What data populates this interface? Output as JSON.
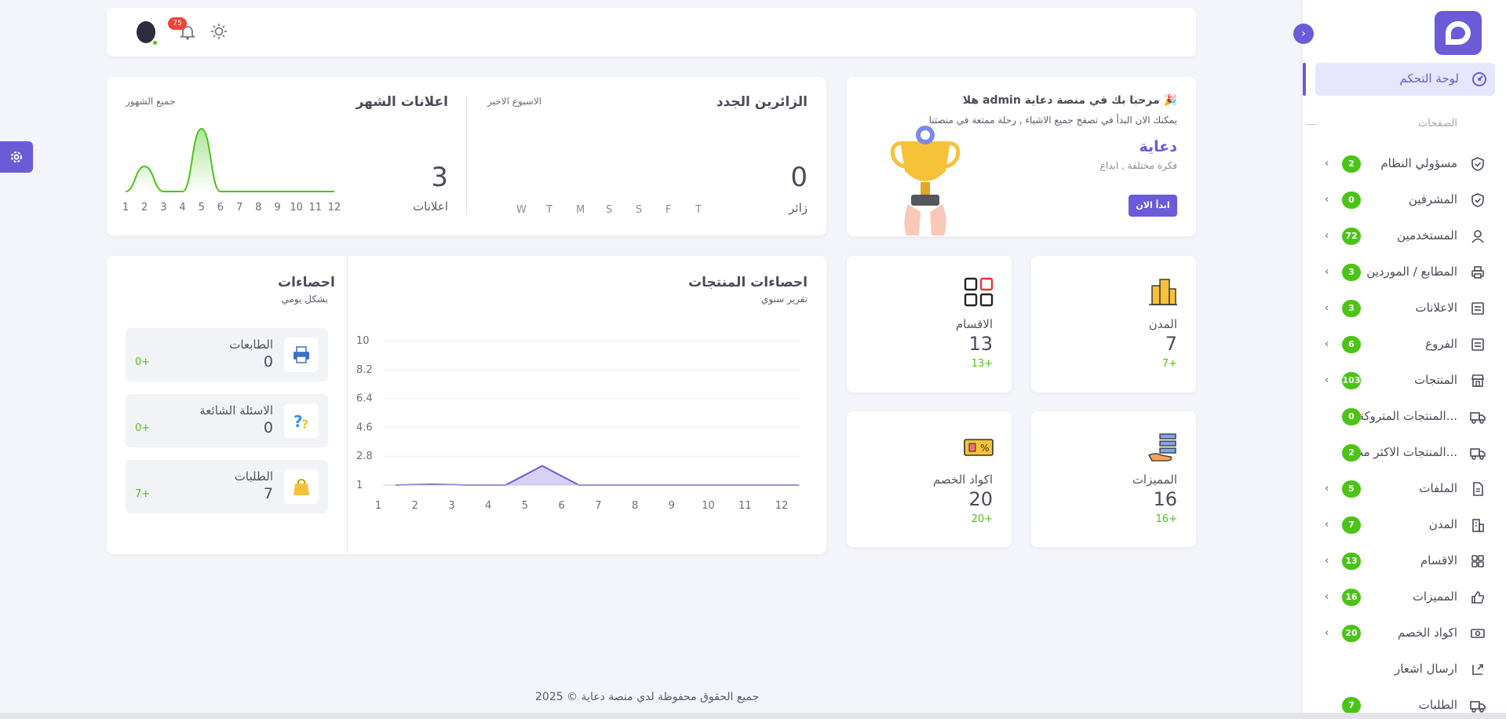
{
  "colors": {
    "accent": "#6b5bd6",
    "success": "#4cc417",
    "danger": "#f04438"
  },
  "header": {
    "notification_count": "75"
  },
  "sidebar": {
    "dashboard_label": "لوحة التحكم",
    "section_pages": "الصفحات",
    "items": [
      {
        "label": "مسؤولي النظام",
        "badge": "2",
        "icon": "shield-icon"
      },
      {
        "label": "المشرفين",
        "badge": "0",
        "icon": "shield-icon"
      },
      {
        "label": "المستخدمين",
        "badge": "72",
        "icon": "user-icon"
      },
      {
        "label": "المطابع / الموردين",
        "badge": "3",
        "icon": "printer-icon"
      },
      {
        "label": "الاعلانات",
        "badge": "3",
        "icon": "list-icon"
      },
      {
        "label": "الفروع",
        "badge": "6",
        "icon": "list-icon"
      },
      {
        "label": "المنتجات",
        "badge": "103",
        "icon": "store-icon"
      },
      {
        "label": "المنتجات المتروكة...",
        "badge": "0",
        "icon": "truck-icon"
      },
      {
        "label": "المنتجات الاكثر مب...",
        "badge": "2",
        "icon": "truck-icon"
      },
      {
        "label": "الملفات",
        "badge": "5",
        "icon": "file-icon"
      },
      {
        "label": "المدن",
        "badge": "7",
        "icon": "building-icon"
      },
      {
        "label": "الاقسام",
        "badge": "13",
        "icon": "grid-icon"
      },
      {
        "label": "المميزات",
        "badge": "16",
        "icon": "thumbs-up-icon"
      },
      {
        "label": "اكواد الخصم",
        "badge": "20",
        "icon": "ticket-icon"
      },
      {
        "label": "ارسال اشعار",
        "badge": "",
        "icon": "send-icon"
      },
      {
        "label": "الطلبات",
        "badge": "7",
        "icon": "truck-icon"
      }
    ]
  },
  "welcome": {
    "greeting": "هلا admin مرحبا بك في منصة دعاية 🎉",
    "subtitle": "يمكنك الان البدأ في تصفح جميع الاشياء , رحلة ممتعة في منصتنا",
    "brand": "دعاية",
    "tagline": "فكرة مختلفة , ابداع",
    "cta": "ابدأ الان"
  },
  "visitors": {
    "title": "الزائرين الجدد",
    "period": "الاسبوع الاخير",
    "value": "0",
    "unit": "زائر",
    "days": [
      "T",
      "F",
      "S",
      "S",
      "M",
      "T",
      "W"
    ]
  },
  "monthly_ads": {
    "title": "اعلانات الشهر",
    "period": "جميع الشهور",
    "value": "3",
    "unit": "اعلانات"
  },
  "stats": [
    {
      "label": "المدن",
      "value": "7",
      "delta": "7+",
      "icon": "city-icon"
    },
    {
      "label": "الاقسام",
      "value": "13",
      "delta": "13+",
      "icon": "categories-icon"
    },
    {
      "label": "المميزات",
      "value": "16",
      "delta": "16+",
      "icon": "features-icon"
    },
    {
      "label": "اكواد الخصم",
      "value": "20",
      "delta": "20+",
      "icon": "coupon-icon"
    }
  ],
  "product_stats": {
    "title": "احصاءات المنتجات",
    "subtitle": "تقرير سنوي"
  },
  "daily_stats": {
    "title": "احصاءات",
    "subtitle": "بشكل يومي",
    "rows": [
      {
        "label": "الطابعات",
        "value": "0",
        "delta": "0+",
        "icon": "printer-icon"
      },
      {
        "label": "الاسئلة الشائعة",
        "value": "0",
        "delta": "0+",
        "icon": "question-icon"
      },
      {
        "label": "الطلبات",
        "value": "7",
        "delta": "7+",
        "icon": "bag-icon"
      }
    ]
  },
  "footer": {
    "text": "جميع الحقوق محفوظة لدي منصة دعاية © 2025"
  },
  "chart_data": [
    {
      "type": "area",
      "x": [
        1,
        2,
        3,
        4,
        5,
        6,
        7,
        8,
        9,
        10,
        11,
        12
      ],
      "values": [
        0,
        1,
        0,
        0,
        2.5,
        0,
        0,
        0,
        0,
        0,
        0,
        0
      ],
      "xlabel": "",
      "ylabel": "",
      "grid": false
    },
    {
      "type": "area",
      "x": [
        1,
        2,
        3,
        4,
        5,
        6,
        7,
        8,
        9,
        10,
        11,
        12
      ],
      "values": [
        1,
        1.05,
        1,
        1,
        2.2,
        1,
        1,
        1,
        1,
        1,
        1,
        1
      ],
      "yticks": [
        "1",
        "2.8",
        "4.6",
        "6.4",
        "8.2",
        "10"
      ],
      "ylim": [
        1,
        10
      ],
      "xlabel": "",
      "ylabel": "",
      "grid": true
    }
  ]
}
